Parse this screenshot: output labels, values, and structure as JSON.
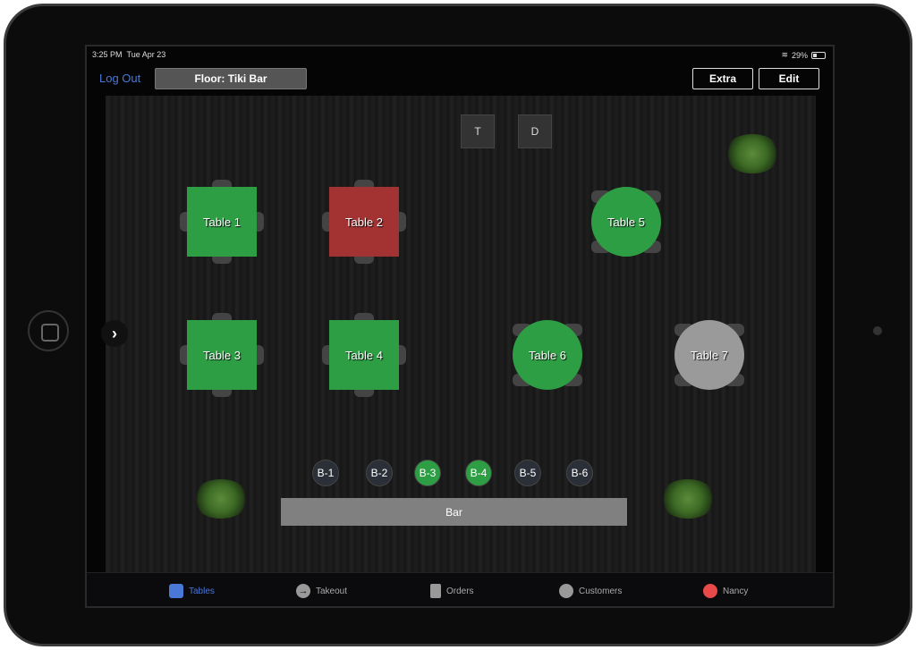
{
  "status": {
    "time": "3:25 PM",
    "date": "Tue Apr 23",
    "battery": "29%"
  },
  "header": {
    "logout": "Log Out",
    "floor": "Floor: Tiki Bar",
    "extra": "Extra",
    "edit": "Edit"
  },
  "colors": {
    "available": "#2e9e45",
    "occupied": "#a33333",
    "inactive": "#9a9a9a",
    "accent": "#4a78d6"
  },
  "tables": [
    {
      "label": "Table 1",
      "shape": "square",
      "status": "available"
    },
    {
      "label": "Table 2",
      "shape": "square",
      "status": "occupied"
    },
    {
      "label": "Table 3",
      "shape": "square",
      "status": "available"
    },
    {
      "label": "Table 4",
      "shape": "square",
      "status": "available"
    },
    {
      "label": "Table 5",
      "shape": "round",
      "status": "available"
    },
    {
      "label": "Table 6",
      "shape": "round",
      "status": "available"
    },
    {
      "label": "Table 7",
      "shape": "round",
      "status": "inactive"
    }
  ],
  "markers": [
    "T",
    "D"
  ],
  "stools": [
    {
      "label": "B-1",
      "status": "empty"
    },
    {
      "label": "B-2",
      "status": "empty"
    },
    {
      "label": "B-3",
      "status": "available"
    },
    {
      "label": "B-4",
      "status": "available"
    },
    {
      "label": "B-5",
      "status": "empty"
    },
    {
      "label": "B-6",
      "status": "empty"
    }
  ],
  "bar": "Bar",
  "tabbar": [
    {
      "label": "Tables",
      "icon": "table-icon",
      "active": true
    },
    {
      "label": "Takeout",
      "icon": "arrow-circle-icon"
    },
    {
      "label": "Orders",
      "icon": "clipboard-icon"
    },
    {
      "label": "Customers",
      "icon": "person-icon"
    },
    {
      "label": "Nancy",
      "icon": "user-avatar-icon"
    }
  ]
}
